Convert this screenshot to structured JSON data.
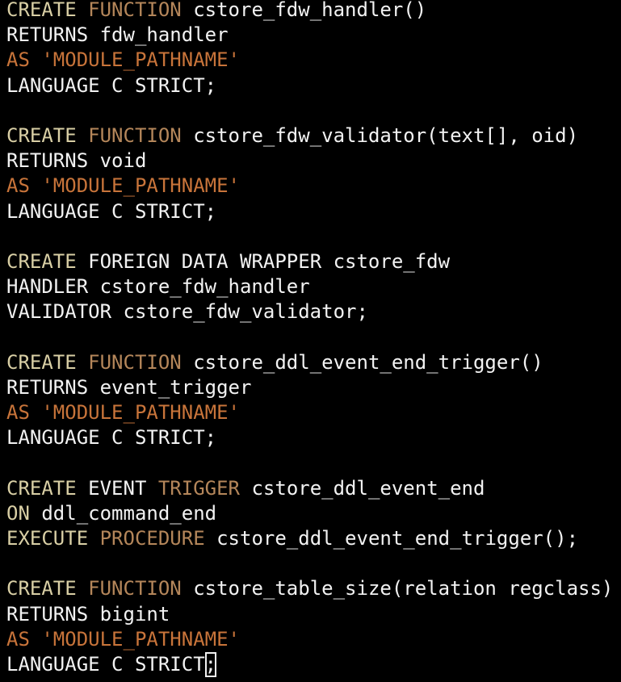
{
  "colors": {
    "background": "#000000",
    "keyword": "#d9cfa5",
    "keyword_secondary": "#b4865a",
    "string": "#c8743a",
    "text": "#f2f2f2"
  },
  "lines": [
    [
      {
        "t": "kw",
        "v": "CREATE"
      },
      {
        "t": "plain",
        "v": " "
      },
      {
        "t": "kw2",
        "v": "FUNCTION"
      },
      {
        "t": "plain",
        "v": " cstore_fdw_handler()"
      }
    ],
    [
      {
        "t": "plain",
        "v": "RETURNS fdw_handler"
      }
    ],
    [
      {
        "t": "str",
        "v": "AS 'MODULE_PATHNAME'"
      }
    ],
    [
      {
        "t": "plain",
        "v": "LANGUAGE C STRICT;"
      }
    ],
    [],
    [
      {
        "t": "kw",
        "v": "CREATE"
      },
      {
        "t": "plain",
        "v": " "
      },
      {
        "t": "kw2",
        "v": "FUNCTION"
      },
      {
        "t": "plain",
        "v": " cstore_fdw_validator(text[], oid)"
      }
    ],
    [
      {
        "t": "plain",
        "v": "RETURNS void"
      }
    ],
    [
      {
        "t": "str",
        "v": "AS 'MODULE_PATHNAME'"
      }
    ],
    [
      {
        "t": "plain",
        "v": "LANGUAGE C STRICT;"
      }
    ],
    [],
    [
      {
        "t": "kw",
        "v": "CREATE"
      },
      {
        "t": "plain",
        "v": " FOREIGN DATA WRAPPER cstore_fdw"
      }
    ],
    [
      {
        "t": "plain",
        "v": "HANDLER cstore_fdw_handler"
      }
    ],
    [
      {
        "t": "plain",
        "v": "VALIDATOR cstore_fdw_validator;"
      }
    ],
    [],
    [
      {
        "t": "kw",
        "v": "CREATE"
      },
      {
        "t": "plain",
        "v": " "
      },
      {
        "t": "kw2",
        "v": "FUNCTION"
      },
      {
        "t": "plain",
        "v": " cstore_ddl_event_end_trigger()"
      }
    ],
    [
      {
        "t": "plain",
        "v": "RETURNS event_trigger"
      }
    ],
    [
      {
        "t": "str",
        "v": "AS 'MODULE_PATHNAME'"
      }
    ],
    [
      {
        "t": "plain",
        "v": "LANGUAGE C STRICT;"
      }
    ],
    [],
    [
      {
        "t": "kw",
        "v": "CREATE"
      },
      {
        "t": "plain",
        "v": " EVENT "
      },
      {
        "t": "kw2",
        "v": "TRIGGER"
      },
      {
        "t": "plain",
        "v": " cstore_ddl_event_end"
      }
    ],
    [
      {
        "t": "kw",
        "v": "ON"
      },
      {
        "t": "plain",
        "v": " ddl_command_end"
      }
    ],
    [
      {
        "t": "kw",
        "v": "EXECUTE"
      },
      {
        "t": "plain",
        "v": " "
      },
      {
        "t": "kw2",
        "v": "PROCEDURE"
      },
      {
        "t": "plain",
        "v": " cstore_ddl_event_end_trigger();"
      }
    ],
    [],
    [
      {
        "t": "kw",
        "v": "CREATE"
      },
      {
        "t": "plain",
        "v": " "
      },
      {
        "t": "kw2",
        "v": "FUNCTION"
      },
      {
        "t": "plain",
        "v": " cstore_table_size(relation regclass)"
      }
    ],
    [
      {
        "t": "plain",
        "v": "RETURNS bigint"
      }
    ],
    [
      {
        "t": "str",
        "v": "AS 'MODULE_PATHNAME'"
      }
    ],
    [
      {
        "t": "plain",
        "v": "LANGUAGE C STRICT"
      },
      {
        "t": "cursor",
        "v": ";"
      }
    ]
  ]
}
